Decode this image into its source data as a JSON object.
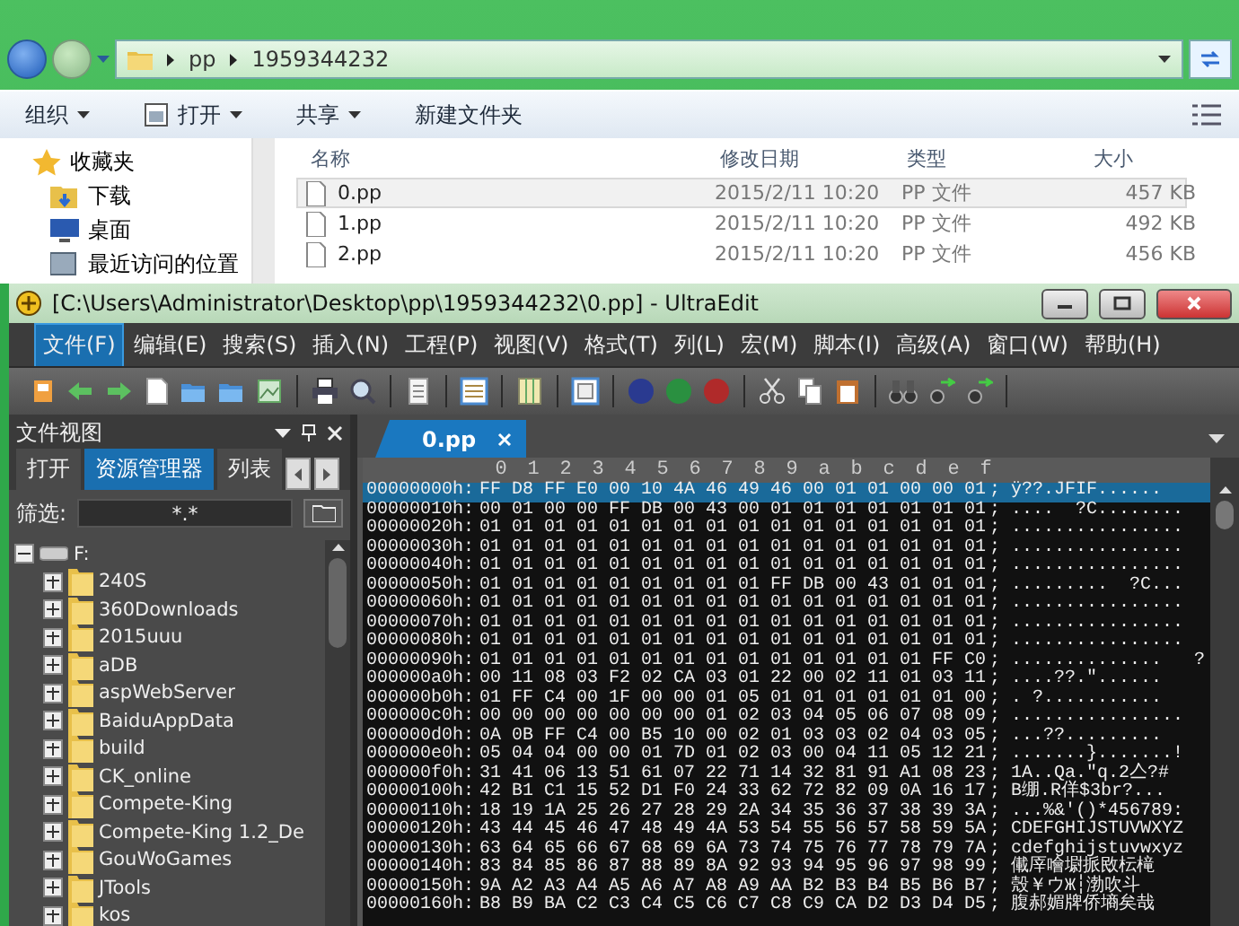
{
  "explorer": {
    "address": [
      "pp",
      "1959344232"
    ],
    "toolbar": [
      {
        "label": "组织",
        "kind": "menu"
      },
      {
        "label": "打开",
        "kind": "icon-menu"
      },
      {
        "label": "共享",
        "kind": "menu"
      },
      {
        "label": "新建文件夹",
        "kind": "button"
      }
    ],
    "sidebar": [
      {
        "label": "收藏夹",
        "kind": "favorites"
      },
      {
        "label": "下载",
        "kind": "download"
      },
      {
        "label": "桌面",
        "kind": "desktop"
      },
      {
        "label": "最近访问的位置",
        "kind": "recent"
      }
    ],
    "columns": [
      "名称",
      "修改日期",
      "类型",
      "大小"
    ],
    "files": [
      {
        "name": "0.pp",
        "modified": "2015/2/11 10:20",
        "type": "PP 文件",
        "size": "457 KB",
        "selected": true
      },
      {
        "name": "1.pp",
        "modified": "2015/2/11 10:20",
        "type": "PP 文件",
        "size": "492 KB",
        "selected": false
      },
      {
        "name": "2.pp",
        "modified": "2015/2/11 10:20",
        "type": "PP 文件",
        "size": "456 KB",
        "selected": false
      }
    ]
  },
  "ultraedit": {
    "title": "[C:\\Users\\Administrator\\Desktop\\pp\\1959344232\\0.pp] - UltraEdit",
    "menu": [
      {
        "label": "文件(F)",
        "selected": true
      },
      {
        "label": "编辑(E)",
        "selected": false
      },
      {
        "label": "搜索(S)",
        "selected": false
      },
      {
        "label": "插入(N)",
        "selected": false
      },
      {
        "label": "工程(P)",
        "selected": false
      },
      {
        "label": "视图(V)",
        "selected": false
      },
      {
        "label": "格式(T)",
        "selected": false
      },
      {
        "label": "列(L)",
        "selected": false
      },
      {
        "label": "宏(M)",
        "selected": false
      },
      {
        "label": "脚本(I)",
        "selected": false
      },
      {
        "label": "高级(A)",
        "selected": false
      },
      {
        "label": "窗口(W)",
        "selected": false
      },
      {
        "label": "帮助(H)",
        "selected": false
      }
    ],
    "file_view": {
      "title": "文件视图",
      "tabs": [
        {
          "label": "打开",
          "selected": false
        },
        {
          "label": "资源管理器",
          "selected": true
        },
        {
          "label": "列表",
          "selected": false
        }
      ],
      "filter_label": "筛选:",
      "filter_value": "*.*",
      "tree": [
        {
          "label": "F:",
          "kind": "drive",
          "expanded": true,
          "children": [
            {
              "label": "240S",
              "kind": "folder",
              "expanded": false
            },
            {
              "label": "360Downloads",
              "kind": "folder",
              "expanded": false
            },
            {
              "label": "2015uuu",
              "kind": "folder",
              "expanded": false
            },
            {
              "label": "aDB",
              "kind": "folder",
              "expanded": false
            },
            {
              "label": "aspWebServer",
              "kind": "folder",
              "expanded": false
            },
            {
              "label": "BaiduAppData",
              "kind": "folder",
              "expanded": false
            },
            {
              "label": "build",
              "kind": "folder",
              "expanded": false
            },
            {
              "label": "CK_online",
              "kind": "folder",
              "expanded": false
            },
            {
              "label": "Compete-King",
              "kind": "folder",
              "expanded": false
            },
            {
              "label": "Compete-King 1.2_De",
              "kind": "folder",
              "expanded": false
            },
            {
              "label": "GouWoGames",
              "kind": "folder",
              "expanded": false
            },
            {
              "label": "JTools",
              "kind": "folder",
              "expanded": false
            },
            {
              "label": "kos",
              "kind": "folder",
              "expanded": false
            }
          ]
        }
      ]
    },
    "document": {
      "tabs": [
        {
          "label": "0.pp",
          "selected": true
        }
      ],
      "columns": [
        "0",
        "1",
        "2",
        "3",
        "4",
        "5",
        "6",
        "7",
        "8",
        "9",
        "a",
        "b",
        "c",
        "d",
        "e",
        "f"
      ],
      "rows": [
        {
          "offset": "00000000h:",
          "bytes": "FF D8 FF E0 00 10 4A 46 49 46 00 01 01 00 00 01",
          "text": "; ÿ??.JFIF......",
          "selected": true
        },
        {
          "offset": "00000010h:",
          "bytes": "00 01 00 00 FF DB 00 43 00 01 01 01 01 01 01 01",
          "text": "; ....  ?C........",
          "selected": false
        },
        {
          "offset": "00000020h:",
          "bytes": "01 01 01 01 01 01 01 01 01 01 01 01 01 01 01 01",
          "text": "; ................",
          "selected": false
        },
        {
          "offset": "00000030h:",
          "bytes": "01 01 01 01 01 01 01 01 01 01 01 01 01 01 01 01",
          "text": "; ................",
          "selected": false
        },
        {
          "offset": "00000040h:",
          "bytes": "01 01 01 01 01 01 01 01 01 01 01 01 01 01 01 01",
          "text": "; ................",
          "selected": false
        },
        {
          "offset": "00000050h:",
          "bytes": "01 01 01 01 01 01 01 01 01 FF DB 00 43 01 01 01",
          "text": "; .........  ?C...",
          "selected": false
        },
        {
          "offset": "00000060h:",
          "bytes": "01 01 01 01 01 01 01 01 01 01 01 01 01 01 01 01",
          "text": "; ................",
          "selected": false
        },
        {
          "offset": "00000070h:",
          "bytes": "01 01 01 01 01 01 01 01 01 01 01 01 01 01 01 01",
          "text": "; ................",
          "selected": false
        },
        {
          "offset": "00000080h:",
          "bytes": "01 01 01 01 01 01 01 01 01 01 01 01 01 01 01 01",
          "text": "; ................",
          "selected": false
        },
        {
          "offset": "00000090h:",
          "bytes": "01 01 01 01 01 01 01 01 01 01 01 01 01 01 FF C0",
          "text": "; ..............   ?",
          "selected": false
        },
        {
          "offset": "000000a0h:",
          "bytes": "00 11 08 03 F2 02 CA 03 01 22 00 02 11 01 03 11",
          "text": "; ....??.\"......",
          "selected": false
        },
        {
          "offset": "000000b0h:",
          "bytes": "01 FF C4 00 1F 00 00 01 05 01 01 01 01 01 01 00",
          "text": "; . ?...........",
          "selected": false
        },
        {
          "offset": "000000c0h:",
          "bytes": "00 00 00 00 00 00 00 01 02 03 04 05 06 07 08 09",
          "text": "; ................",
          "selected": false
        },
        {
          "offset": "000000d0h:",
          "bytes": "0A 0B FF C4 00 B5 10 00 02 01 03 03 02 04 03 05",
          "text": "; ...??.........",
          "selected": false
        },
        {
          "offset": "000000e0h:",
          "bytes": "05 04 04 00 00 01 7D 01 02 03 00 04 11 05 12 21",
          "text": "; .......}.......!",
          "selected": false
        },
        {
          "offset": "000000f0h:",
          "bytes": "31 41 06 13 51 61 07 22 71 14 32 81 91 A1 08 23",
          "text": "; 1A..Qa.\"q.2亼?#",
          "selected": false
        },
        {
          "offset": "00000100h:",
          "bytes": "42 B1 C1 15 52 D1 F0 24 33 62 72 82 09 0A 16 17",
          "text": "; B绷.R佯$3br?...",
          "selected": false
        },
        {
          "offset": "00000110h:",
          "bytes": "18 19 1A 25 26 27 28 29 2A 34 35 36 37 38 39 3A",
          "text": "; ...%&'()*456789:",
          "selected": false
        },
        {
          "offset": "00000120h:",
          "bytes": "43 44 45 46 47 48 49 4A 53 54 55 56 57 58 59 5A",
          "text": "; CDEFGHIJSTUVWXYZ",
          "selected": false
        },
        {
          "offset": "00000130h:",
          "bytes": "63 64 65 66 67 68 69 6A 73 74 75 76 77 78 79 7A",
          "text": "; cdefghijstuvwxyz",
          "selected": false
        },
        {
          "offset": "00000140h:",
          "bytes": "83 84 85 86 87 88 89 8A 92 93 94 95 96 97 98 99",
          "text": "; 儎厗噲墛挀敃枟槞",
          "selected": false
        },
        {
          "offset": "00000150h:",
          "bytes": "9A A2 A3 A4 A5 A6 A7 A8 A9 AA B2 B3 B4 B5 B6 B7",
          "text": "; 殼￥ウЖ┆渤吹斗",
          "selected": false
        },
        {
          "offset": "00000160h:",
          "bytes": "B8 B9 BA C2 C3 C4 C5 C6 C7 C8 C9 CA D2 D3 D4 D5",
          "text": "; 腹郝媚牌侨墒矣哉",
          "selected": false
        }
      ]
    }
  }
}
